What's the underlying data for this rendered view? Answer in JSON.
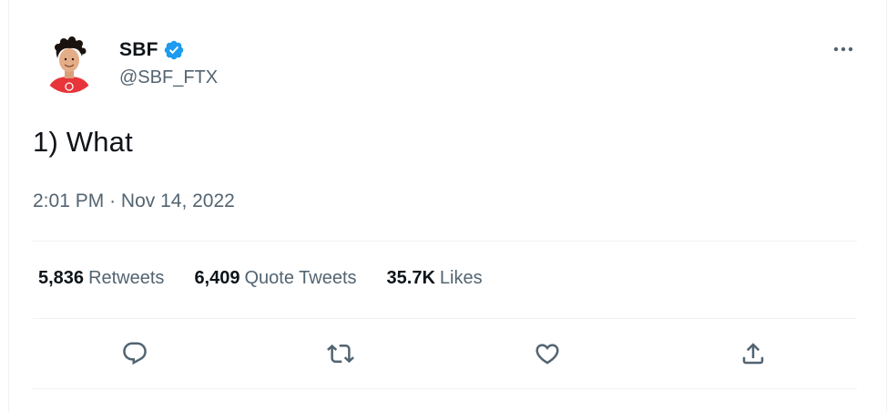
{
  "author": {
    "display_name": "SBF",
    "handle": "@SBF_FTX",
    "verified": true,
    "avatar_icon": "profile-photo"
  },
  "tweet": {
    "text": "1) What",
    "time": "2:01 PM",
    "separator": "·",
    "date": "Nov 14, 2022"
  },
  "stats": {
    "retweets_count": "5,836",
    "retweets_label": "Retweets",
    "quotes_count": "6,409",
    "quotes_label": "Quote Tweets",
    "likes_count": "35.7K",
    "likes_label": "Likes"
  },
  "actions": [
    {
      "name": "reply",
      "icon": "reply-icon"
    },
    {
      "name": "retweet",
      "icon": "retweet-icon"
    },
    {
      "name": "like",
      "icon": "heart-icon"
    },
    {
      "name": "share",
      "icon": "share-icon"
    }
  ],
  "colors": {
    "text_primary": "#0f1419",
    "text_secondary": "#536471",
    "verified_blue": "#1d9bf0",
    "divider": "#eff3f4",
    "avatar_shirt": "#e8353a"
  }
}
